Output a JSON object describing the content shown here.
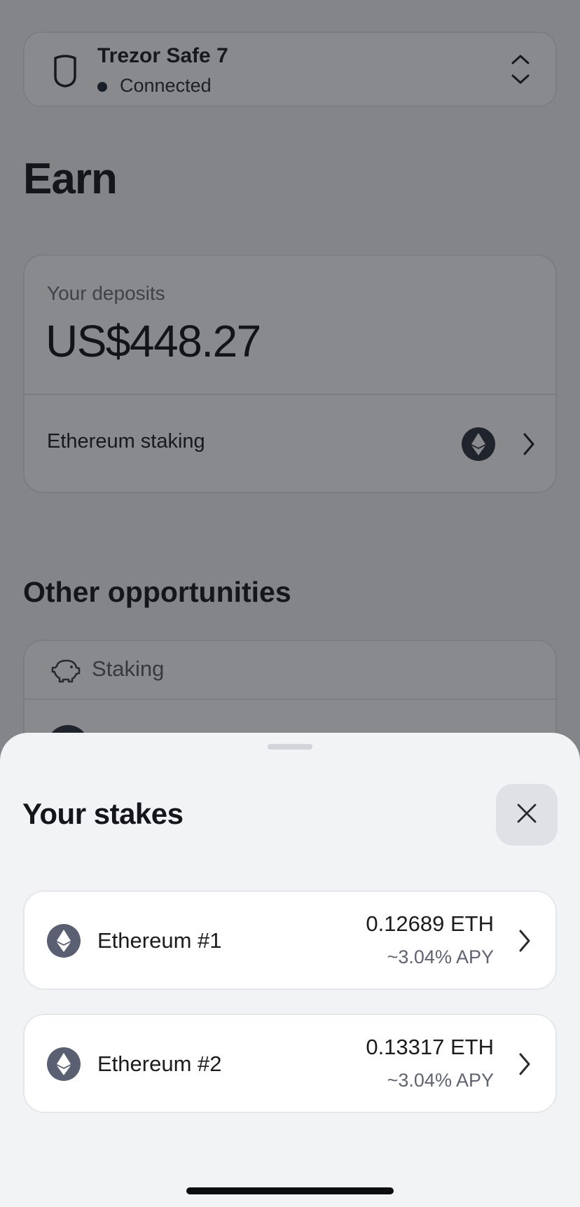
{
  "device": {
    "name": "Trezor Safe 7",
    "status": "Connected"
  },
  "page": {
    "title": "Earn"
  },
  "deposits": {
    "label": "Your deposits",
    "amount": "US$448.27",
    "row_label": "Ethereum staking"
  },
  "opportunities": {
    "title": "Other opportunities",
    "category_label": "Staking"
  },
  "sheet": {
    "title": "Your stakes",
    "stakes": [
      {
        "name": "Ethereum #1",
        "amount": "0.12689 ETH",
        "apy": "~3.04% APY"
      },
      {
        "name": "Ethereum #2",
        "amount": "0.13317 ETH",
        "apy": "~3.04% APY"
      }
    ]
  },
  "colors": {
    "accent_dark": "#2d323c",
    "eth_icon_bg": "#5b5f72",
    "sheet_bg": "#f2f3f5"
  },
  "icons": {
    "device": "shield-icon",
    "selector": "chevron-up-down-icon",
    "eth": "ethereum-icon",
    "row": "chevron-right-icon",
    "staking": "piggy-bank-icon",
    "close": "close-icon"
  }
}
